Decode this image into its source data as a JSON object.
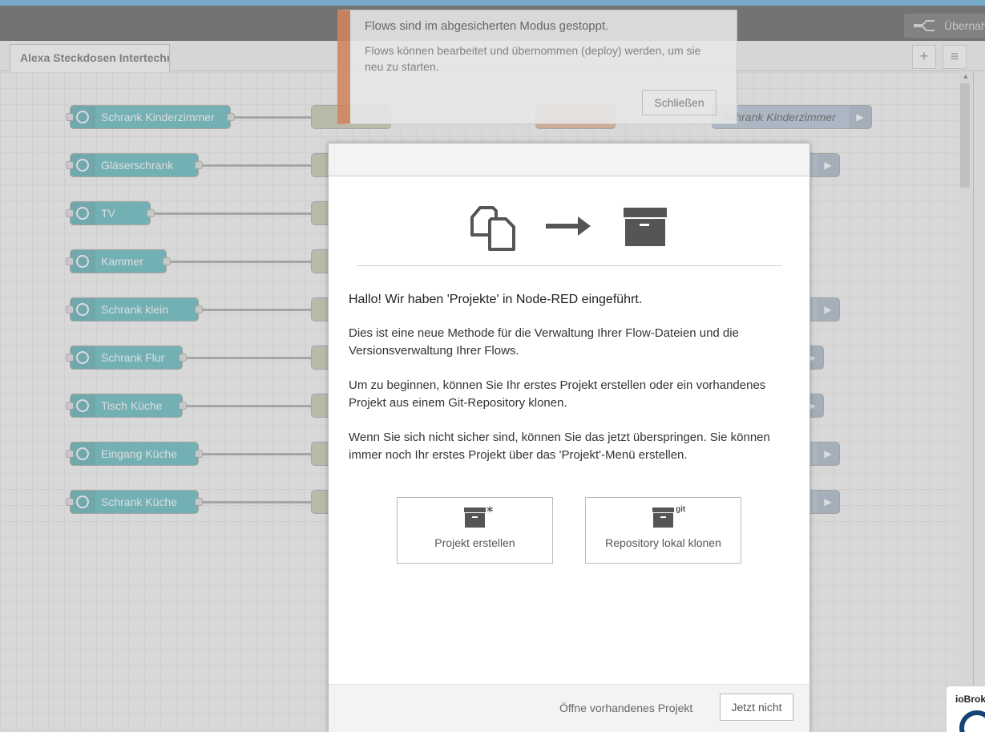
{
  "header": {
    "deploy_label": "Übernahme"
  },
  "tabs": [
    {
      "label": "Alexa Steckdosen Intertechno"
    }
  ],
  "tab_actions": {
    "add": "+",
    "list": "≡"
  },
  "flow": {
    "input_nodes": [
      {
        "label": "Schrank Kinderzimmer"
      },
      {
        "label": "Gläserschrank"
      },
      {
        "label": "TV"
      },
      {
        "label": "Kammer"
      },
      {
        "label": "Schrank klein"
      },
      {
        "label": "Schrank Flur"
      },
      {
        "label": "Tisch Küche"
      },
      {
        "label": "Eingang Küche"
      },
      {
        "label": "Schrank Küche"
      }
    ],
    "output_nodes": [
      {
        "label": "Schrank Kinderzimmer"
      }
    ]
  },
  "notification": {
    "title": "Flows sind im abgesicherten Modus gestoppt.",
    "body": "Flows können bearbeitet und übernommen (deploy) werden, um sie neu zu starten.",
    "close_label": "Schließen"
  },
  "dialog": {
    "title": "Hallo! Wir haben 'Projekte' in Node-RED eingeführt.",
    "paragraph1": "Dies ist eine neue Methode für die Verwaltung Ihrer Flow-Dateien und die Versionsverwaltung Ihrer Flows.",
    "paragraph2": "Um zu beginnen, können Sie Ihr erstes Projekt erstellen oder ein vorhandenes Projekt aus einem Git-Repository klonen.",
    "paragraph3": "Wenn Sie sich nicht sicher sind, können Sie das jetzt überspringen. Sie können immer noch Ihr erstes Projekt über das 'Projekt'-Menü erstellen.",
    "create_label": "Projekt erstellen",
    "clone_label": "Repository lokal klonen",
    "clone_badge": "git",
    "open_existing_label": "Öffne vorhandenes Projekt",
    "not_now_label": "Jetzt nicht"
  },
  "iobroker": {
    "label": "ioBroker"
  },
  "colors": {
    "input_node": "#3fadb5",
    "switch_node": "#c0c0a0",
    "output_node": "#a6bbcf",
    "notification_accent": "#d0855f",
    "header": "#3f3f3f"
  }
}
